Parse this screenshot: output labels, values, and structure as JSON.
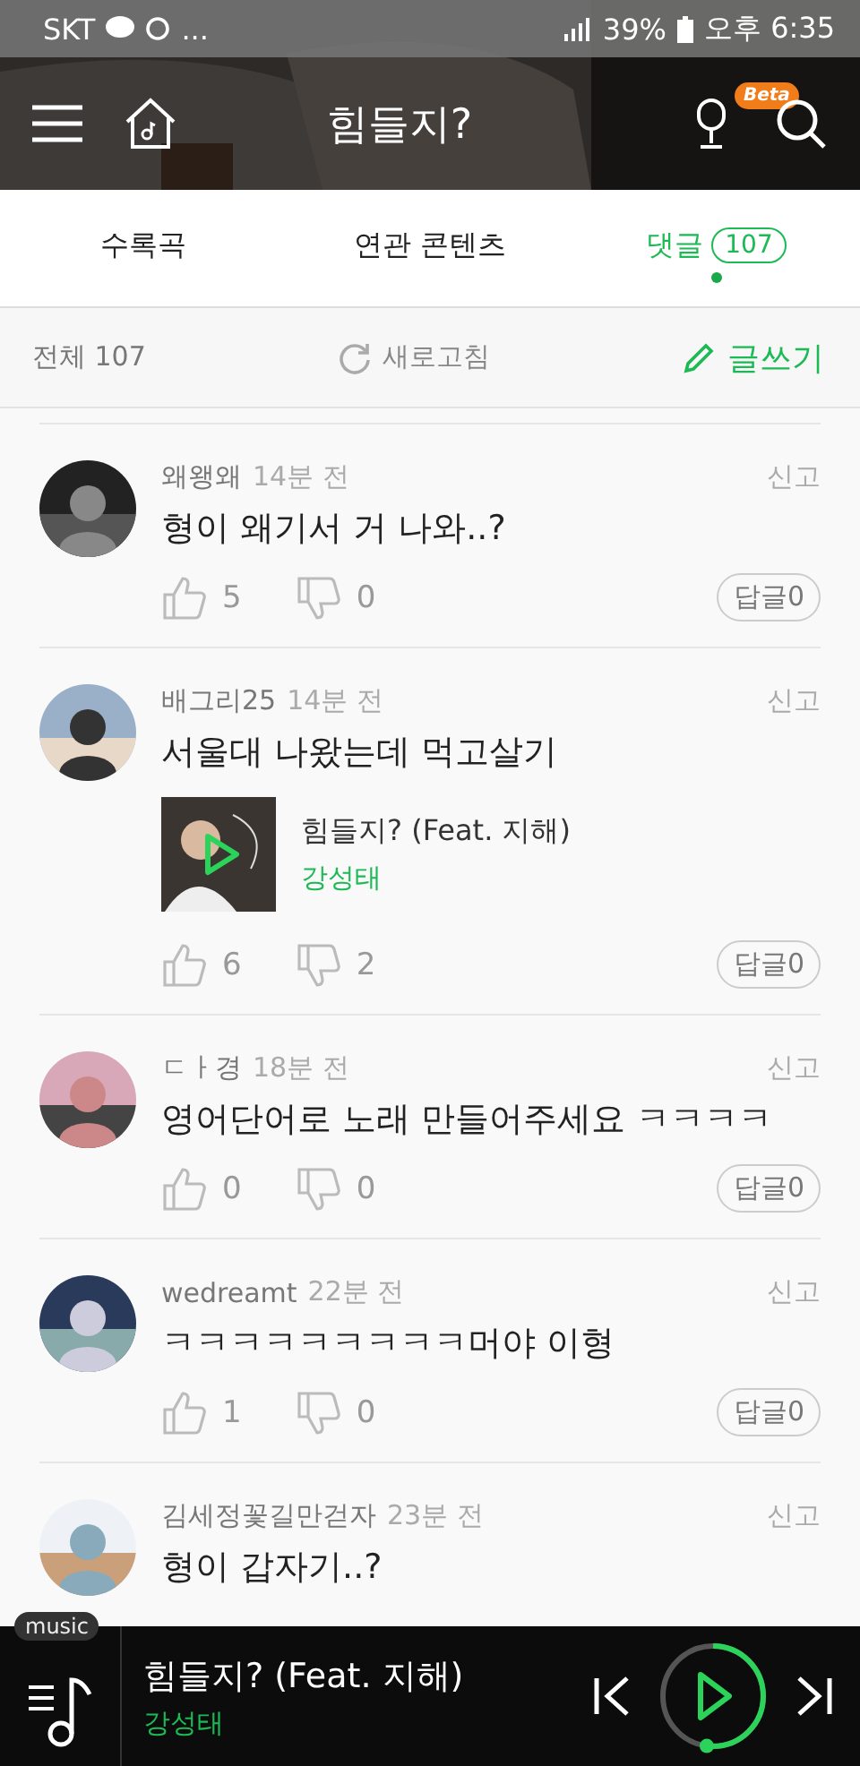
{
  "status_bar": {
    "carrier": "SKT",
    "more": "...",
    "battery": "39%",
    "time": "오후 6:35"
  },
  "header": {
    "title": "힘들지?",
    "beta_badge": "Beta"
  },
  "tabs": [
    {
      "label": "수록곡",
      "selected": false
    },
    {
      "label": "연관 콘텐츠",
      "selected": false
    },
    {
      "label": "댓글",
      "count": "107",
      "selected": true
    }
  ],
  "toolbar": {
    "total": "전체 107",
    "refresh": "새로고침",
    "write": "글쓰기"
  },
  "comments": [
    {
      "user": "왜왱왜",
      "time": "14분 전",
      "report": "신고",
      "text": "형이 왜기서 거 나와..?",
      "likes": "5",
      "dislikes": "0",
      "reply": "답글0"
    },
    {
      "user": "배그리25",
      "time": "14분 전",
      "report": "신고",
      "text": "서울대 나왔는데 먹고살기",
      "song": {
        "title": "힘들지? (Feat. 지해)",
        "artist": "강성태"
      },
      "likes": "6",
      "dislikes": "2",
      "reply": "답글0"
    },
    {
      "user": "ㄷㅏ경",
      "time": "18분 전",
      "report": "신고",
      "text": "영어단어로 노래 만들어주세요 ㅋㅋㅋㅋ",
      "likes": "0",
      "dislikes": "0",
      "reply": "답글0"
    },
    {
      "user": "wedreamt",
      "time": "22분 전",
      "report": "신고",
      "text": "ㅋㅋㅋㅋㅋㅋㅋㅋㅋ머야 이형",
      "likes": "1",
      "dislikes": "0",
      "reply": "답글0"
    },
    {
      "user": "김세정꽃길만걷자",
      "time": "23분 전",
      "report": "신고",
      "text": "형이 갑자기..?"
    }
  ],
  "player": {
    "badge": "music",
    "title": "힘들지? (Feat. 지해)",
    "artist": "강성태",
    "level": 0.52
  }
}
